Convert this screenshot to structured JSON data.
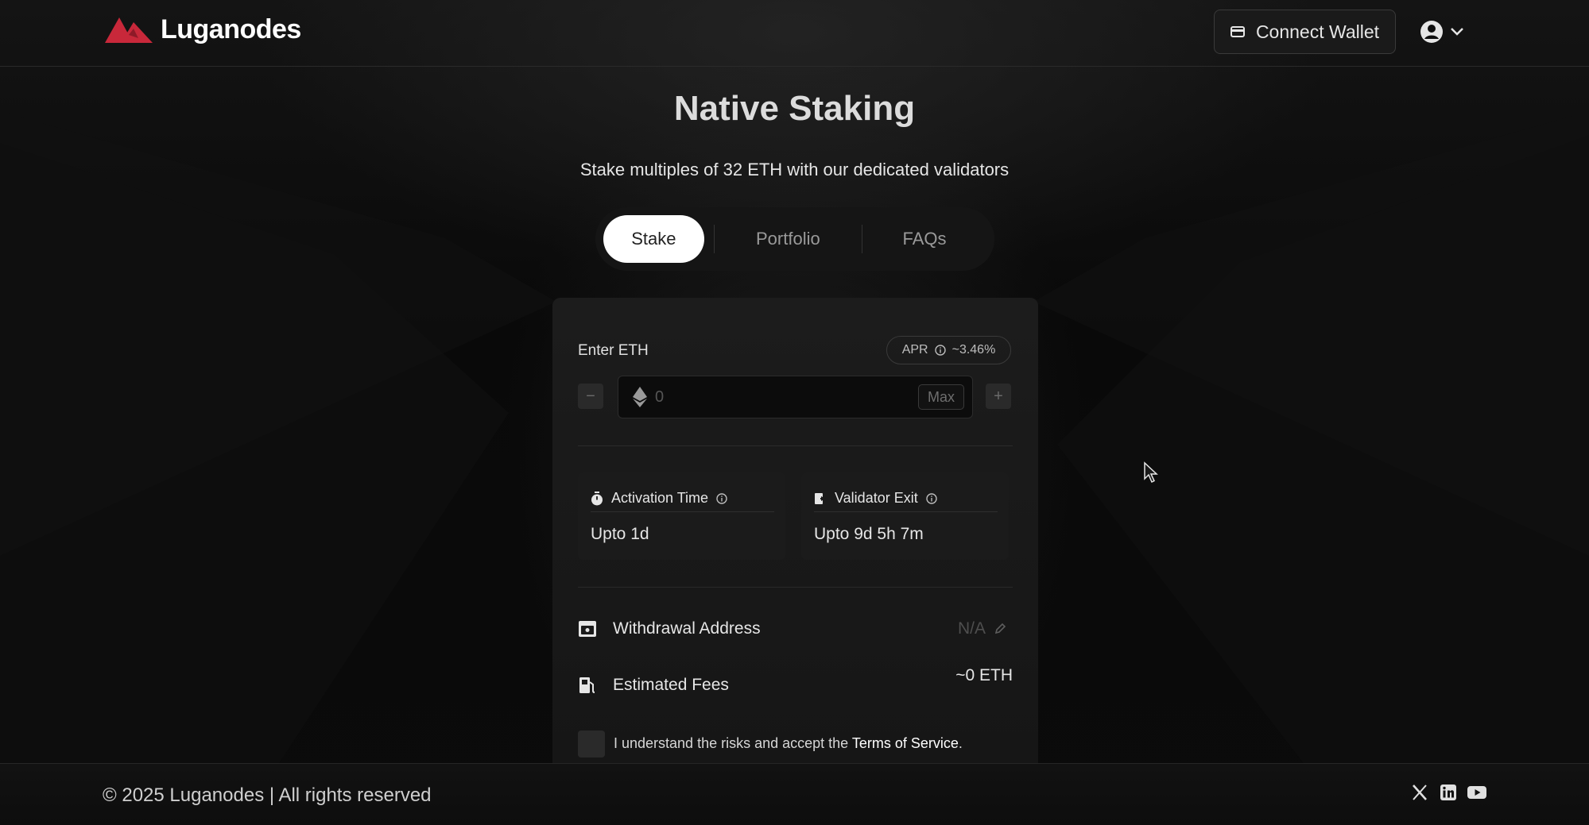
{
  "header": {
    "logo_text": "Luganodes",
    "connect_wallet_label": "Connect Wallet"
  },
  "page": {
    "title": "Native Staking",
    "subtitle": "Stake multiples of 32 ETH with our dedicated validators"
  },
  "tabs": [
    {
      "label": "Stake",
      "active": true
    },
    {
      "label": "Portfolio",
      "active": false
    },
    {
      "label": "FAQs",
      "active": false
    }
  ],
  "stake_form": {
    "enter_label": "Enter ETH",
    "apr_label": "APR",
    "apr_value": "~3.46%",
    "input_placeholder": "0",
    "max_label": "Max",
    "decrement_label": "−",
    "increment_label": "+",
    "activation": {
      "label": "Activation Time",
      "value": "Upto 1d"
    },
    "validator_exit": {
      "label": "Validator Exit",
      "value": "Upto 9d 5h 7m"
    },
    "withdrawal_address": {
      "label": "Withdrawal Address",
      "value": "N/A"
    },
    "estimated_fees": {
      "label": "Estimated Fees",
      "value": "~0 ETH"
    },
    "terms_prefix": "I understand the risks and accept the ",
    "terms_link": "Terms of Service",
    "terms_suffix": "."
  },
  "footer": {
    "copyright": "© 2025 Luganodes | All rights reserved"
  },
  "colors": {
    "brand_red": "#c8283a",
    "background": "#0a0a0a",
    "active_tab": "#ffffff"
  },
  "icons": [
    "logo-mark-icon",
    "wallet-icon",
    "user-icon",
    "chevron-down-icon",
    "info-icon",
    "ethereum-icon",
    "stopwatch-icon",
    "exit-icon",
    "vault-icon",
    "fuel-icon",
    "edit-icon",
    "x-icon",
    "linkedin-icon",
    "youtube-icon"
  ]
}
